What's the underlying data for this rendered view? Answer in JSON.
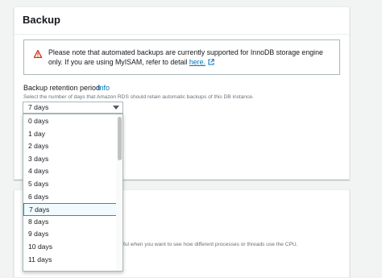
{
  "backup": {
    "title": "Backup",
    "alert": {
      "icon": "warning-icon",
      "text_before_link": "Please note that automated backups are currently supported for InnoDB storage engine only. If you are using MyISAM, refer to detail ",
      "link_text": "here.",
      "link_icon": "external-link-icon"
    },
    "retention": {
      "label": "Backup retention period",
      "info": "Info",
      "description": "Select the number of days that Amazon RDS should retain automatic backups of this DB instance.",
      "selected_value": "7 days",
      "options": [
        "0 days",
        "1 day",
        "2 days",
        "3 days",
        "4 days",
        "5 days",
        "6 days",
        "7 days",
        "8 days",
        "9 days",
        "10 days",
        "11 days"
      ]
    }
  },
  "monitoring": {
    "description_fragment": "ful when you want to see how different processes or threads use the CPU."
  },
  "colors": {
    "accent_link": "#0073bb",
    "warning": "#d13212",
    "selected_border": "#00a1c9",
    "selected_bg": "#f1faff"
  }
}
